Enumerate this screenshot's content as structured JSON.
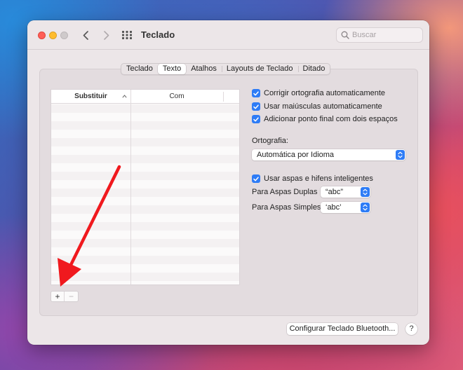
{
  "window": {
    "title": "Teclado",
    "search_placeholder": "Buscar"
  },
  "tabs": [
    {
      "label": "Teclado",
      "active": false
    },
    {
      "label": "Texto",
      "active": true
    },
    {
      "label": "Atalhos",
      "active": false
    },
    {
      "label": "Layouts de Teclado",
      "active": false
    },
    {
      "label": "Ditado",
      "active": false
    }
  ],
  "table": {
    "col_replace": "Substituir",
    "col_with": "Com",
    "rows": []
  },
  "table_controls": {
    "add_label": "+",
    "remove_label": "−"
  },
  "options": {
    "autocorrect": {
      "label": "Corrigir ortografia automaticamente",
      "checked": true
    },
    "capitalize": {
      "label": "Usar maiúsculas automaticamente",
      "checked": true
    },
    "period": {
      "label": "Adicionar ponto final com dois espaços",
      "checked": true
    }
  },
  "spelling": {
    "label": "Ortografia:",
    "value": "Automática por Idioma"
  },
  "smart_quotes": {
    "label": "Usar aspas e hifens inteligentes",
    "checked": true,
    "double_label": "Para Aspas Duplas",
    "double_value": "“abc”",
    "single_label": "Para Aspas Simples",
    "single_value": "‘abc’"
  },
  "footer": {
    "bluetooth_label": "Configurar Teclado Bluetooth...",
    "help_label": "?"
  },
  "colors": {
    "accent": "#2e7cf6",
    "annotation_arrow": "#f0191e",
    "close": "#ff5f57",
    "minimize": "#febc2e"
  }
}
